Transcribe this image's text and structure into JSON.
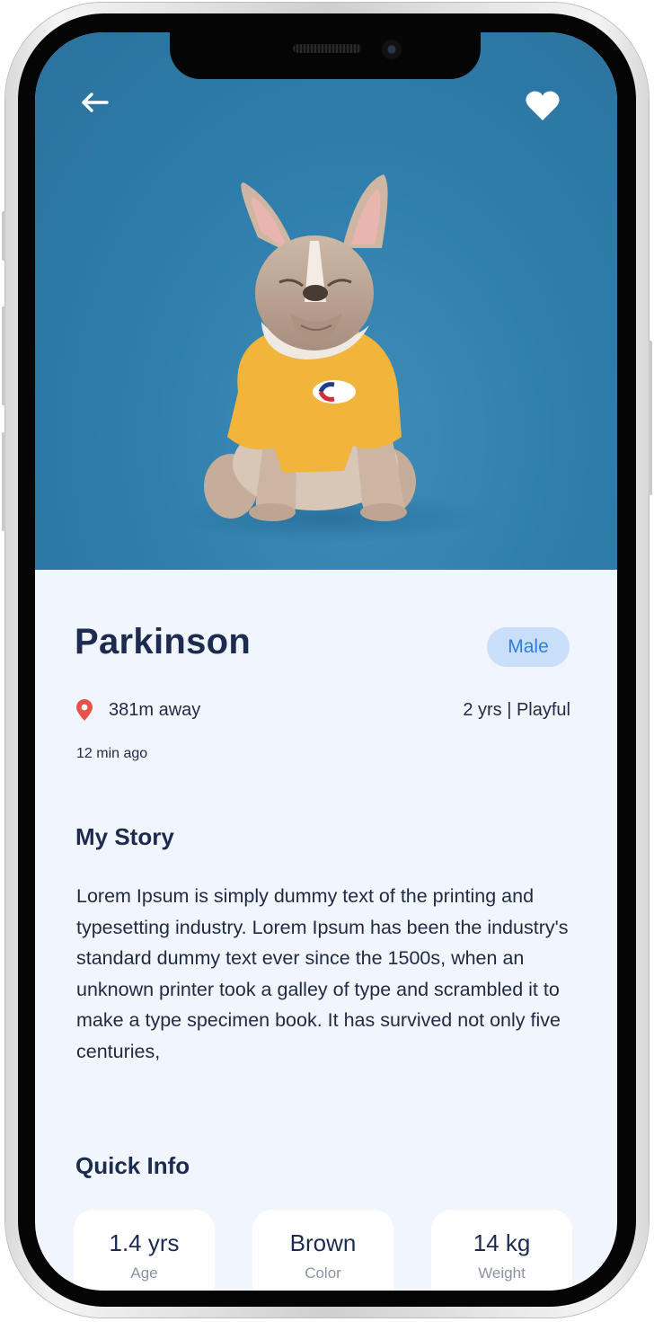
{
  "colors": {
    "hero_background": "#2f7eac",
    "page_background": "#f1f5fc",
    "title_text": "#1c2b4f",
    "badge_background": "#c9def8",
    "badge_text": "#2f7ee0",
    "location_pin": "#e5534b"
  },
  "icons": {
    "back": "arrow-left-icon",
    "favorite": "heart-icon",
    "location": "location-pin-icon"
  },
  "pet": {
    "name": "Parkinson",
    "gender": "Male",
    "distance": "381m away",
    "age_temperament": "2 yrs | Playful",
    "posted_time": "12 min ago"
  },
  "story": {
    "title": "My Story",
    "text": "Lorem Ipsum is simply dummy text of the printing and typesetting industry. Lorem Ipsum has been the industry's standard dummy text ever since the 1500s, when an unknown printer took a galley of type and scrambled it to make a type specimen book. It has survived not only five centuries,"
  },
  "quick_info": {
    "title": "Quick Info",
    "cards": [
      {
        "value": "1.4 yrs",
        "label": "Age"
      },
      {
        "value": "Brown",
        "label": "Color"
      },
      {
        "value": "14 kg",
        "label": "Weight"
      }
    ]
  }
}
